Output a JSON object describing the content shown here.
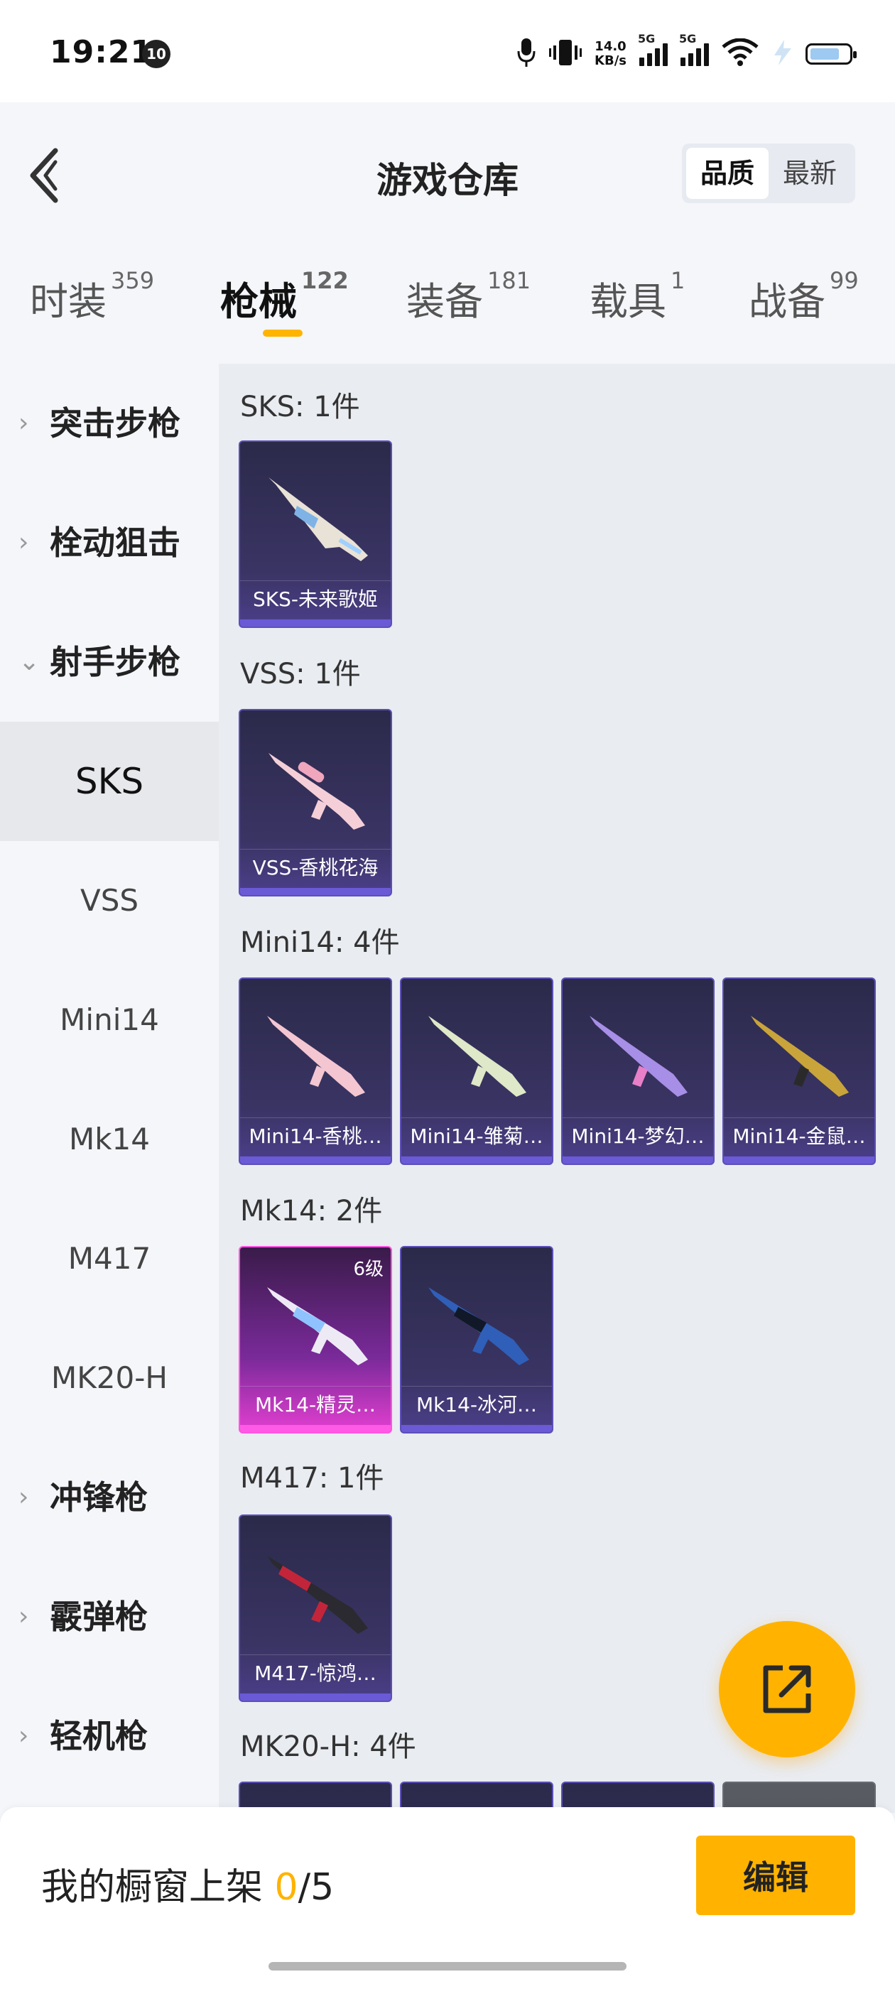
{
  "status_bar": {
    "time": "19:21",
    "badge": "10",
    "net_speed_value": "14.0",
    "net_speed_unit": "KB/s",
    "sim1": "5G",
    "sim2": "5G"
  },
  "header": {
    "title": "游戏仓库",
    "sort_options": [
      "品质",
      "最新"
    ],
    "active_sort": "品质"
  },
  "tabs": [
    {
      "label": "时装",
      "count": "359"
    },
    {
      "label": "枪械",
      "count": "122"
    },
    {
      "label": "装备",
      "count": "181"
    },
    {
      "label": "载具",
      "count": "1"
    },
    {
      "label": "战备",
      "count": "99"
    }
  ],
  "active_tab": "枪械",
  "sidebar": {
    "items": [
      {
        "label": "突击步枪",
        "type": "category",
        "expanded": false
      },
      {
        "label": "栓动狙击",
        "type": "category",
        "expanded": false
      },
      {
        "label": "射手步枪",
        "type": "category",
        "expanded": true
      },
      {
        "label": "SKS",
        "type": "sub",
        "selected": true
      },
      {
        "label": "VSS",
        "type": "sub"
      },
      {
        "label": "Mini14",
        "type": "sub"
      },
      {
        "label": "Mk14",
        "type": "sub"
      },
      {
        "label": "M417",
        "type": "sub"
      },
      {
        "label": "MK20-H",
        "type": "sub"
      },
      {
        "label": "冲锋枪",
        "type": "category",
        "expanded": false
      },
      {
        "label": "霰弹枪",
        "type": "category",
        "expanded": false
      },
      {
        "label": "轻机枪",
        "type": "category",
        "expanded": false
      }
    ]
  },
  "groups": [
    {
      "title": "SKS: 1件",
      "items": [
        {
          "name": "SKS-未来歌姬"
        }
      ]
    },
    {
      "title": "VSS: 1件",
      "items": [
        {
          "name": "VSS-香桃花海"
        }
      ]
    },
    {
      "title": "Mini14: 4件",
      "items": [
        {
          "name": "Mini14-香桃…"
        },
        {
          "name": "Mini14-雏菊…"
        },
        {
          "name": "Mini14-梦幻…"
        },
        {
          "name": "Mini14-金鼠…"
        }
      ]
    },
    {
      "title": "Mk14: 2件",
      "items": [
        {
          "name": "Mk14-精灵…",
          "level": "6级"
        },
        {
          "name": "Mk14-冰河…"
        }
      ]
    },
    {
      "title": "M417: 1件",
      "items": [
        {
          "name": "M417-惊鸿…"
        }
      ]
    },
    {
      "title": "MK20-H: 4件",
      "items": []
    }
  ],
  "bottom_bar": {
    "label": "我的橱窗上架",
    "current": "0",
    "separator": "/",
    "total": "5",
    "edit_label": "编辑"
  },
  "colors": {
    "accent": "#ffb300",
    "card_border": "#5c4fb8",
    "card_pink": "#ff55e0"
  },
  "icons": [
    "back-arrow-icon",
    "share-external-icon",
    "chevron-right-icon",
    "chevron-down-icon",
    "mic-icon",
    "vibrate-icon",
    "wifi-icon",
    "battery-icon"
  ]
}
